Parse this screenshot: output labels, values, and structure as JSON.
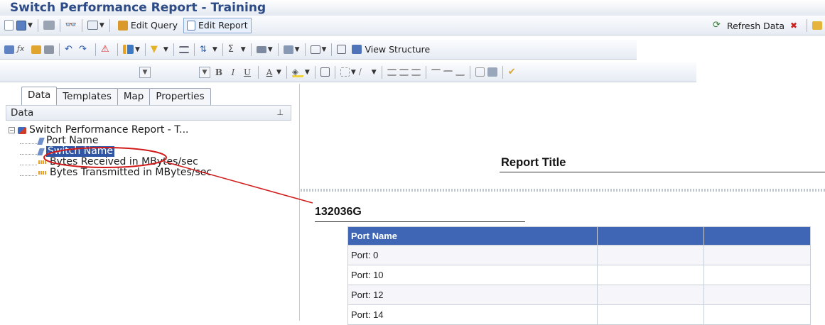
{
  "window": {
    "title": "Switch Performance Report - Training"
  },
  "toolbar1": {
    "edit_query": "Edit Query",
    "edit_report": "Edit Report",
    "refresh_data": "Refresh Data"
  },
  "toolbar2": {
    "view_structure": "View Structure"
  },
  "toolbar3": {
    "bold": "B",
    "italic": "I",
    "underline": "U",
    "font_color": "A"
  },
  "left_panel": {
    "tabs": [
      "Data",
      "Templates",
      "Map",
      "Properties"
    ],
    "header": "Data",
    "tree": {
      "root": "Switch Performance Report - T...",
      "items": [
        {
          "label": "Port Name",
          "kind": "dimension"
        },
        {
          "label": "Switch Name",
          "kind": "dimension",
          "selected": true
        },
        {
          "label": "Bytes Received in MBytes/sec",
          "kind": "measure"
        },
        {
          "label": "Bytes Transmitted in MBytes/sec",
          "kind": "measure"
        }
      ]
    }
  },
  "report": {
    "title": "Report Title",
    "group_value": "132036G",
    "table": {
      "headers": [
        "Port Name",
        "",
        ""
      ],
      "rows": [
        [
          "Port: 0",
          "",
          ""
        ],
        [
          "Port: 10",
          "",
          ""
        ],
        [
          "Port: 12",
          "",
          ""
        ],
        [
          "Port: 14",
          "",
          ""
        ]
      ]
    }
  },
  "colors": {
    "title_text": "#2b4a86",
    "table_header": "#3f66b4",
    "selection": "#2f55a4",
    "annotation": "#d11a1a"
  }
}
